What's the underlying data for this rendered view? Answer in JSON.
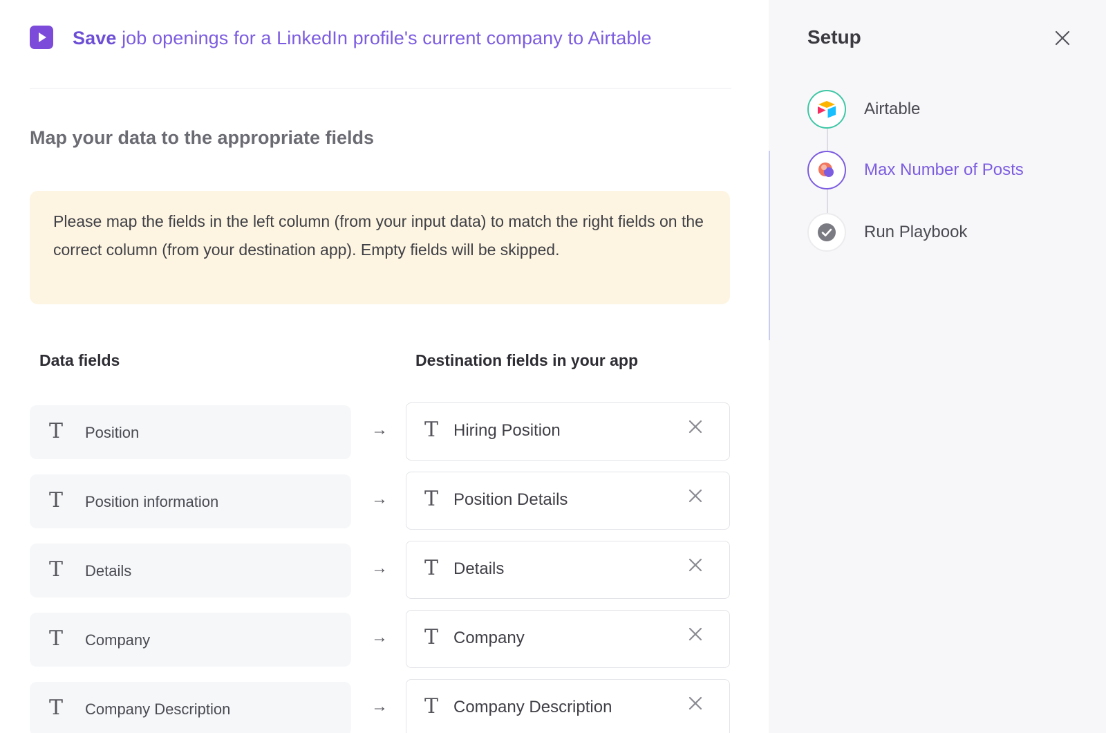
{
  "header": {
    "title_strong": "Save",
    "title_rest": " job openings for a LinkedIn profile's current company to Airtable"
  },
  "mapping": {
    "section_title": "Map your data to the appropriate fields",
    "notice": "Please map the fields in the left column (from your input data) to match the right fields on the correct column (from your destination app). Empty fields will be skipped.",
    "left_header": "Data fields",
    "right_header": "Destination fields in your app",
    "arrow_glyph": "→",
    "type_glyph": "T",
    "rows": [
      {
        "source": "Position",
        "destination": "Hiring Position"
      },
      {
        "source": "Position information",
        "destination": "Position Details"
      },
      {
        "source": "Details",
        "destination": "Details"
      },
      {
        "source": "Company",
        "destination": "Company"
      },
      {
        "source": "Company Description",
        "destination": "Company Description"
      }
    ]
  },
  "setup": {
    "title": "Setup",
    "steps": [
      {
        "label": "Airtable",
        "icon": "airtable-logo-icon",
        "state": "complete"
      },
      {
        "label": "Max Number of Posts",
        "icon": "posts-app-icon",
        "state": "active"
      },
      {
        "label": "Run Playbook",
        "icon": "check-circle-icon",
        "state": "pending"
      }
    ]
  },
  "colors": {
    "accent": "#7c5ce0",
    "play_button": "#7c4bd9",
    "notice_bg": "#fdf5e1",
    "step_complete_ring": "#3ec7a5",
    "step_active_ring": "#7c5ce0"
  }
}
